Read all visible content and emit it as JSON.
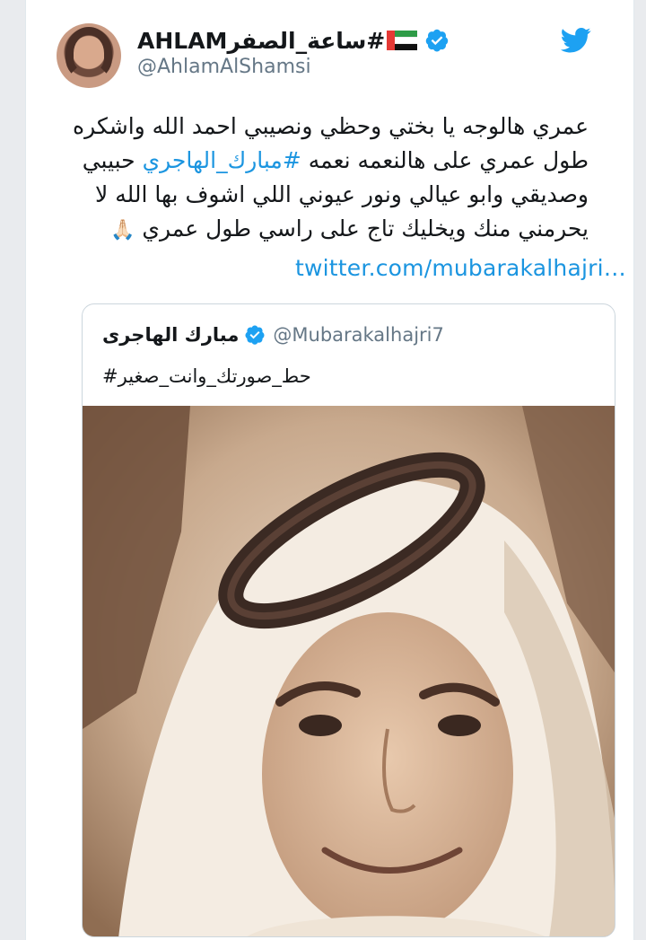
{
  "tweet": {
    "display_name": "AHLAMساعة_الصفر#",
    "handle": "@AhlamAlShamsi",
    "text_line1": "عمري هالوجه يا بختي وحظي ونصيبي احمد الله واشكره",
    "text_line2_before": "طول عمري على هالنعمه نعمه ",
    "hashtag": "#مبارك_الهاجري",
    "text_line2_after": " حبيبي",
    "text_line3": "وصديقي وابو عيالي ونور عيوني اللي اشوف بها الله لا",
    "text_line4": "يحرمني منك ويخليك تاج على راسي طول عمري",
    "emoji": "🙏🏻",
    "link": "twitter.com/mubarakalhajri…"
  },
  "quoted": {
    "display_name": "مبارك الهاجرى",
    "handle": "@Mubarakalhajri7",
    "text": "#حط_صورتك_وانت_صغير"
  },
  "icons": {
    "verified": "verified-badge-icon",
    "bird": "twitter-bird-icon",
    "flag": "uae-flag-icon"
  },
  "colors": {
    "link_blue": "#1b95e0",
    "verified_blue": "#1da1f2",
    "text_dark": "#14171a",
    "text_gray": "#657786"
  }
}
